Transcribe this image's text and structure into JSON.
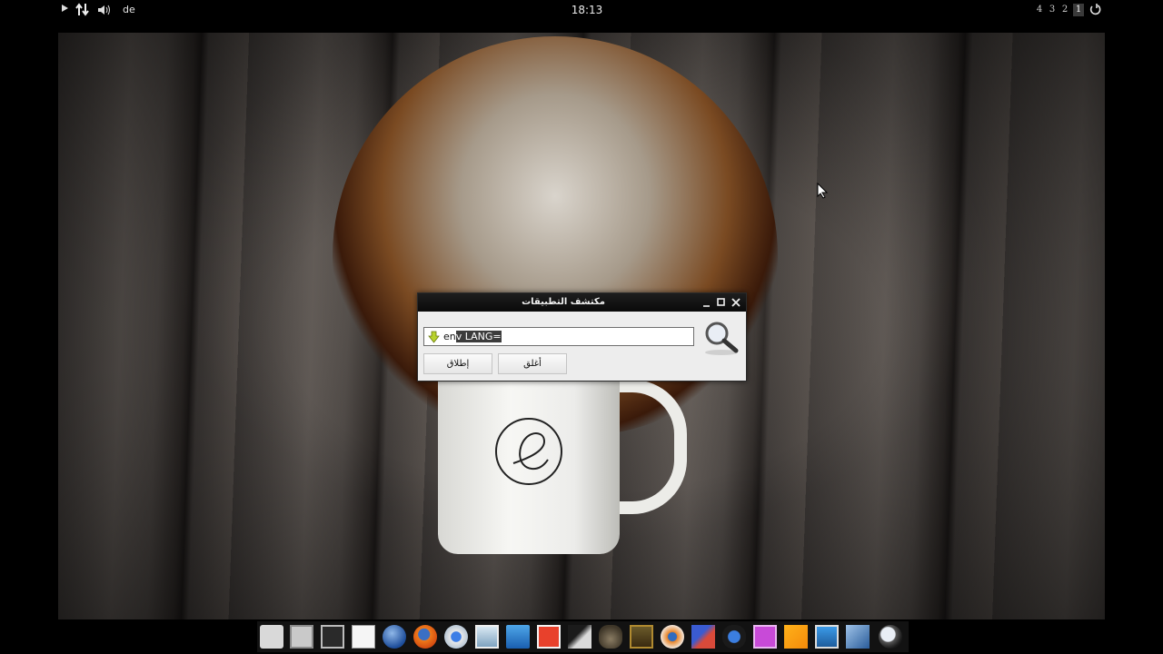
{
  "top_panel": {
    "play_icon": "play-icon",
    "network_icon": "network-arrows-icon",
    "volume_icon": "volume-icon",
    "keyboard_layout": "de",
    "clock": "18:13",
    "workspaces": [
      "4",
      "3",
      "2",
      "1"
    ],
    "active_workspace": "1",
    "power_icon": "power-icon"
  },
  "app_finder": {
    "title": "مكتشف التطبيقات",
    "search_value_prefix": "en",
    "search_value_selected": "v LANG=",
    "launch_button": "إطلاق",
    "close_button": "أغلق"
  },
  "dock": {
    "icons": [
      "archive-icon",
      "files-icon",
      "terminal-icon",
      "text-editor-icon",
      "globe-icon",
      "firefox-icon",
      "chromium-icon",
      "image-viewer-icon",
      "window-icon",
      "pdf-icon",
      "inkscape-icon",
      "gimp-icon",
      "mona-lisa-icon",
      "blender-icon",
      "dev-tools-icon",
      "audio-editor-icon",
      "video-editor-icon",
      "document-icon",
      "media-player-icon",
      "virtualbox-icon",
      "search-icon"
    ]
  }
}
